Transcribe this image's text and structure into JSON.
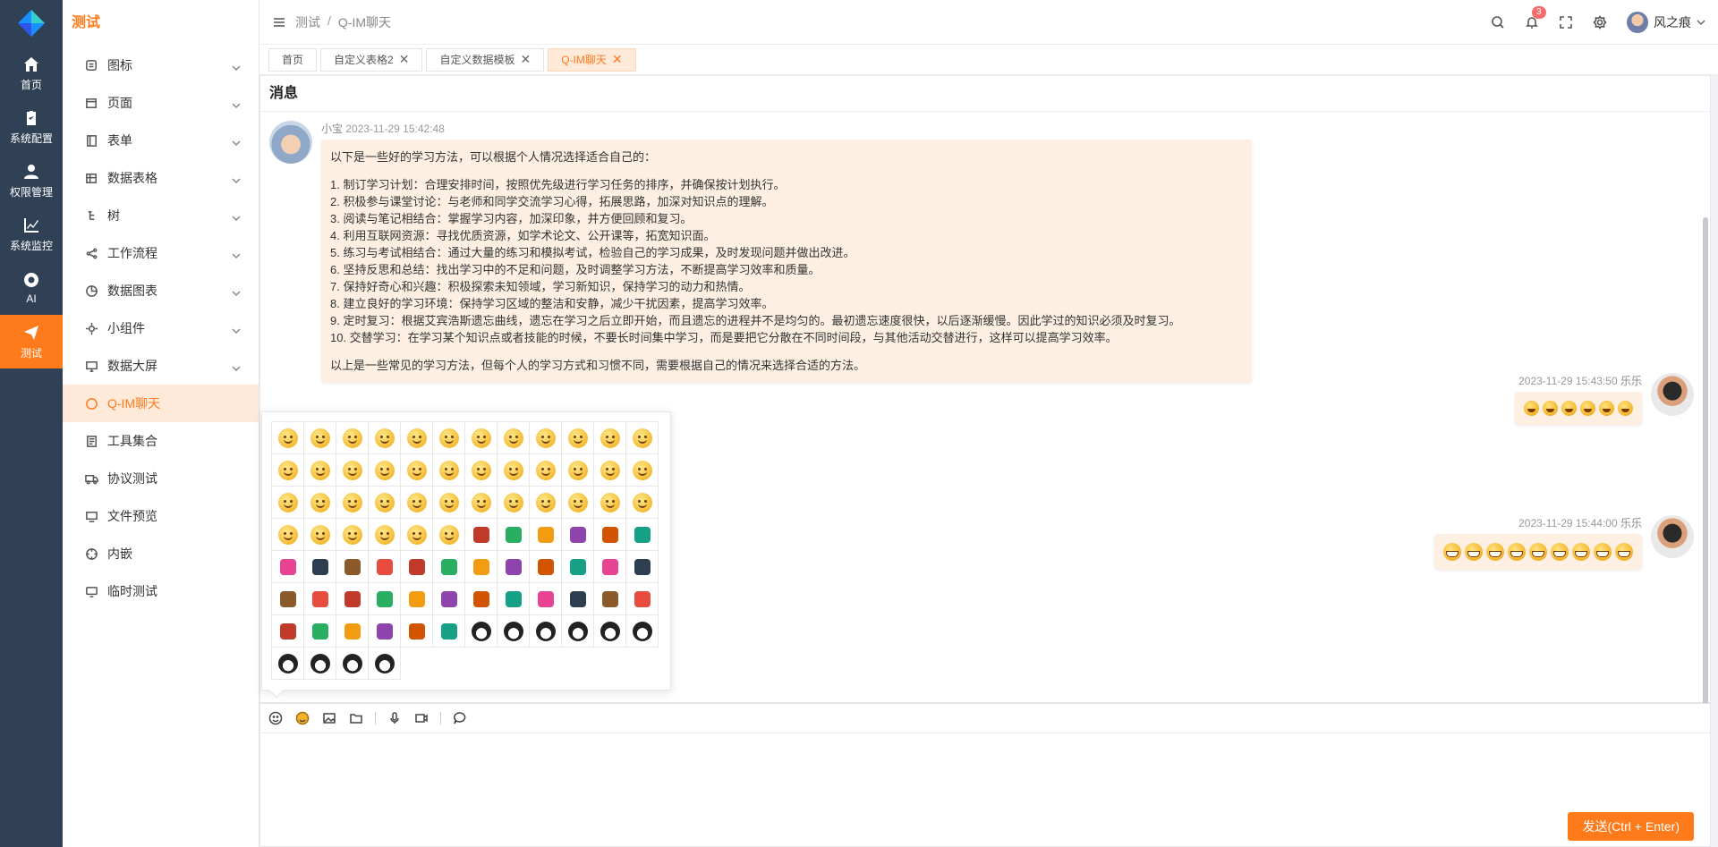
{
  "app": {
    "section_title": "测试"
  },
  "rail": [
    {
      "label": "首页",
      "icon": "home-icon"
    },
    {
      "label": "系统配置",
      "icon": "clipboard-icon"
    },
    {
      "label": "权限管理",
      "icon": "user-icon"
    },
    {
      "label": "系统监控",
      "icon": "chart-icon"
    },
    {
      "label": "AI",
      "icon": "chrome-icon"
    },
    {
      "label": "测试",
      "icon": "paper-plane-icon",
      "active": true
    }
  ],
  "submenu": [
    {
      "label": "图标",
      "icon": "palette-icon",
      "expandable": true
    },
    {
      "label": "页面",
      "icon": "page-icon",
      "expandable": true
    },
    {
      "label": "表单",
      "icon": "form-icon",
      "expandable": true
    },
    {
      "label": "数据表格",
      "icon": "table-icon",
      "expandable": true
    },
    {
      "label": "树",
      "icon": "tree-icon",
      "expandable": true
    },
    {
      "label": "工作流程",
      "icon": "share-icon",
      "expandable": true
    },
    {
      "label": "数据图表",
      "icon": "pie-chart-icon",
      "expandable": true
    },
    {
      "label": "小组件",
      "icon": "widget-icon",
      "expandable": true
    },
    {
      "label": "数据大屏",
      "icon": "monitor-icon",
      "expandable": true
    },
    {
      "label": "Q-IM聊天",
      "icon": "chat-icon",
      "active": true
    },
    {
      "label": "工具集合",
      "icon": "toolbox-icon"
    },
    {
      "label": "协议测试",
      "icon": "truck-icon"
    },
    {
      "label": "文件预览",
      "icon": "preview-icon"
    },
    {
      "label": "内嵌",
      "icon": "compass-icon"
    },
    {
      "label": "临时测试",
      "icon": "flask-icon"
    }
  ],
  "breadcrumb": [
    "测试",
    "/",
    "Q-IM聊天"
  ],
  "topbar": {
    "notification_count": "3",
    "user_name": "风之痕"
  },
  "tabs": [
    {
      "label": "首页",
      "closable": false
    },
    {
      "label": "自定义表格2",
      "closable": true
    },
    {
      "label": "自定义数据模板",
      "closable": true
    },
    {
      "label": "Q-IM聊天",
      "closable": true,
      "active": true
    }
  ],
  "chat": {
    "header": "消息",
    "msg1": {
      "name": "小宝",
      "time": "2023-11-29 15:42:48",
      "intro": "以下是一些好的学习方法，可以根据个人情况选择适合自己的：",
      "items": [
        "1. 制订学习计划：合理安排时间，按照优先级进行学习任务的排序，并确保按计划执行。",
        "2. 积极参与课堂讨论：与老师和同学交流学习心得，拓展思路，加深对知识点的理解。",
        "3. 阅读与笔记相结合：掌握学习内容，加深印象，并方便回顾和复习。",
        "4. 利用互联网资源：寻找优质资源，如学术论文、公开课等，拓宽知识面。",
        "5. 练习与考试相结合：通过大量的练习和模拟考试，检验自己的学习成果，及时发现问题并做出改进。",
        "6. 坚持反思和总结：找出学习中的不足和问题，及时调整学习方法，不断提高学习效率和质量。",
        "7. 保持好奇心和兴趣：积极探索未知领域，学习新知识，保持学习的动力和热情。",
        "8. 建立良好的学习环境：保持学习区域的整洁和安静，减少干扰因素，提高学习效率。",
        "9. 定时复习：根据艾宾浩斯遗忘曲线，遗忘在学习之后立即开始，而且遗忘的进程并不是均匀的。最初遗忘速度很快，以后逐渐缓慢。因此学过的知识必须及时复习。",
        "10. 交替学习：在学习某个知识点或者技能的时候，不要长时间集中学习，而是要把它分散在不同时间段，与其他活动交替进行，这样可以提高学习效率。"
      ],
      "outro": "以上是一些常见的学习方法，但每个人的学习方式和习惯不同，需要根据自己的情况来选择合适的方法。"
    },
    "msg2": {
      "name": "乐乐",
      "time": "2023-11-29 15:43:50",
      "emoji_count": 6
    },
    "msg3": {
      "name": "乐乐",
      "time": "2023-11-29 15:44:00",
      "emoji_count": 9
    }
  },
  "picker": {
    "emoji_count": 88
  },
  "input": {
    "toolbar": [
      "emoji-outline-icon",
      "emoji-filled-icon",
      "image-icon",
      "folder-icon",
      "microphone-icon",
      "video-icon",
      "chat-history-icon"
    ],
    "send_label": "发送(Ctrl + Enter)"
  },
  "colors": {
    "accent": "#ff7a1a",
    "rail_bg": "#304156",
    "bubble": "#fdf0e3"
  }
}
